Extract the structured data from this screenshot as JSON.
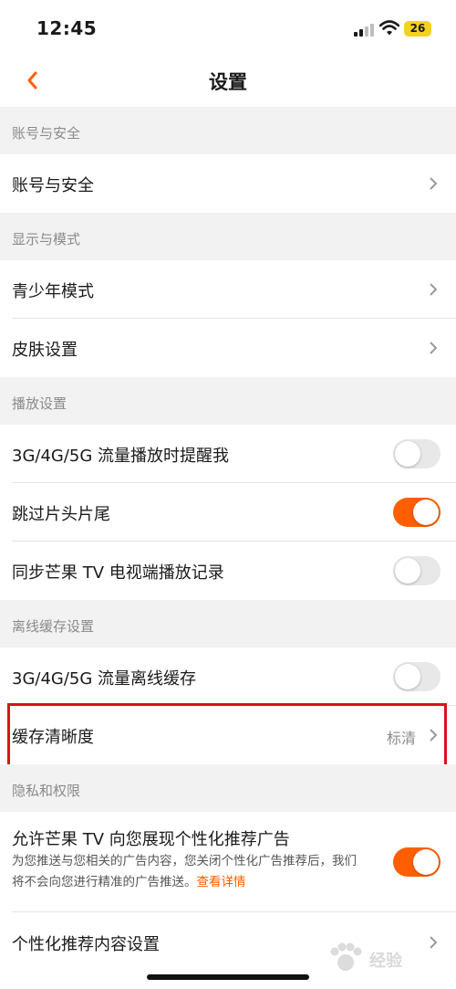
{
  "status_bar": {
    "time": "12:45",
    "battery": "26"
  },
  "nav": {
    "title": "设置"
  },
  "sections": {
    "account": {
      "header": "账号与安全",
      "items": [
        {
          "label": "账号与安全"
        }
      ]
    },
    "display": {
      "header": "显示与模式",
      "items": [
        {
          "label": "青少年模式"
        },
        {
          "label": "皮肤设置"
        }
      ]
    },
    "playback": {
      "header": "播放设置",
      "items": [
        {
          "label": "3G/4G/5G 流量播放时提醒我",
          "toggle_on": false
        },
        {
          "label": "跳过片头片尾",
          "toggle_on": true
        },
        {
          "label": "同步芒果 TV 电视端播放记录",
          "toggle_on": false
        }
      ]
    },
    "offline": {
      "header": "离线缓存设置",
      "items": [
        {
          "label": "3G/4G/5G 流量离线缓存",
          "toggle_on": false
        },
        {
          "label": "缓存清晰度",
          "value": "标清"
        }
      ]
    },
    "privacy": {
      "header": "隐私和权限",
      "items": [
        {
          "label": "允许芒果 TV 向您展现个性化推荐广告",
          "description": "为您推送与您相关的广告内容，您关闭个性化广告推荐后，我们将不会向您进行精准的广告推送。",
          "link": "查看详情",
          "toggle_on": true
        },
        {
          "label": "个性化推荐内容设置"
        }
      ]
    }
  },
  "watermark": {
    "text": "经验"
  },
  "colors": {
    "accent": "#ff5f00",
    "highlight_border": "#d7141a",
    "background": "#f2f2f2"
  }
}
